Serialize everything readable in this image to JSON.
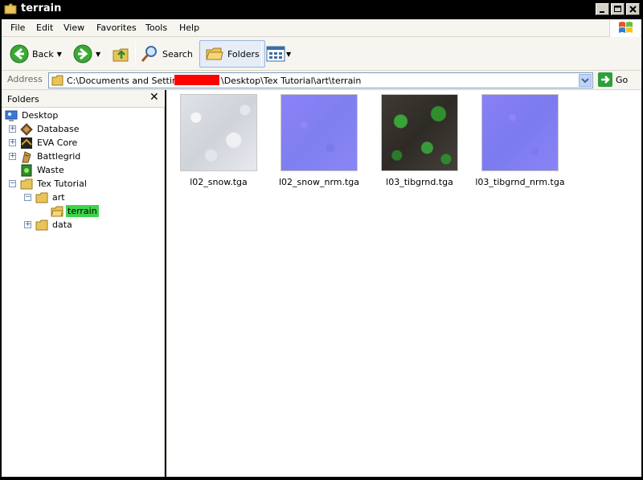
{
  "window": {
    "title": "terrain"
  },
  "menu": [
    "File",
    "Edit",
    "View",
    "Favorites",
    "Tools",
    "Help"
  ],
  "toolbar": {
    "back_label": "Back",
    "search_label": "Search",
    "folders_label": "Folders"
  },
  "address": {
    "label": "Address",
    "path_part1": "C:\\Documents and Settings\\",
    "path_part2": "\\Desktop\\Tex Tutorial\\art\\terrain",
    "go_label": "Go"
  },
  "folders_pane": {
    "title": "Folders",
    "tree": [
      {
        "label": "Desktop",
        "icon": "desktop-icon"
      },
      {
        "label": "Database",
        "icon": "database-icon"
      },
      {
        "label": "EVA Core",
        "icon": "eva-core-icon"
      },
      {
        "label": "Battlegrid",
        "icon": "battlegrid-icon"
      },
      {
        "label": "Waste",
        "icon": "waste-icon"
      },
      {
        "label": "Tex Tutorial",
        "icon": "folder-icon"
      },
      {
        "label": "art",
        "icon": "folder-icon"
      },
      {
        "label": "terrain",
        "icon": "folder-open-icon"
      },
      {
        "label": "data",
        "icon": "folder-icon"
      }
    ]
  },
  "files": [
    {
      "name": "l02_snow.tga",
      "thumb": "snow"
    },
    {
      "name": "l02_snow_nrm.tga",
      "thumb": "normal-map"
    },
    {
      "name": "l03_tibgrnd.tga",
      "thumb": "ground"
    },
    {
      "name": "l03_tibgrnd_nrm.tga",
      "thumb": "normal-map"
    }
  ],
  "colors": {
    "selection": "#3fd34c",
    "redaction": "#ff0000",
    "chrome": "#f6f5f0"
  }
}
